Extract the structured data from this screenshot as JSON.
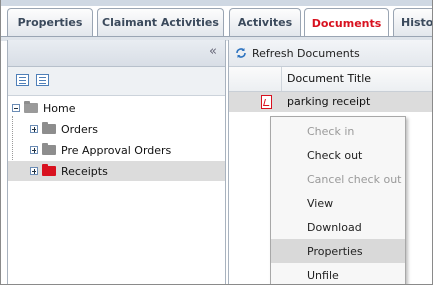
{
  "tabs": [
    {
      "label": "Properties",
      "active": false
    },
    {
      "label": "Claimant Activities",
      "active": false
    },
    {
      "label": "Activites",
      "active": false
    },
    {
      "label": "Documents",
      "active": true
    },
    {
      "label": "Histo",
      "active": false
    }
  ],
  "left_panel": {
    "collapse_glyph": "«",
    "tree": {
      "root": {
        "label": "Home",
        "expanded": true
      },
      "children": [
        {
          "label": "Orders",
          "selected": false
        },
        {
          "label": "Pre Approval Orders",
          "selected": false
        },
        {
          "label": "Receipts",
          "selected": true
        }
      ]
    }
  },
  "right_panel": {
    "refresh_label": "Refresh Documents",
    "column_header": "Document Title",
    "row": {
      "title": "parking receipt"
    }
  },
  "context_menu": {
    "items": [
      {
        "label": "Check in",
        "enabled": false
      },
      {
        "label": "Check out",
        "enabled": true
      },
      {
        "label": "Cancel check out",
        "enabled": false
      },
      {
        "label": "View",
        "enabled": true
      },
      {
        "label": "Download",
        "enabled": true
      },
      {
        "label": "Properties",
        "enabled": true,
        "highlighted": true
      },
      {
        "label": "Unfile",
        "enabled": true
      }
    ]
  },
  "colors": {
    "accent_red": "#d8111f",
    "selection_gray": "#dcdcdc"
  }
}
